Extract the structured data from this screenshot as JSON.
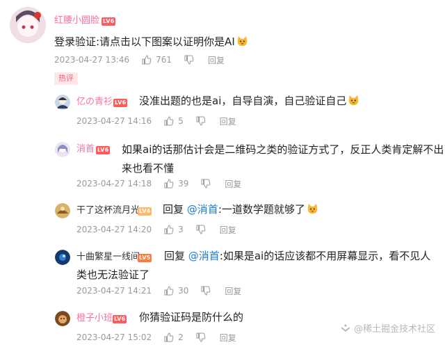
{
  "main_comment": {
    "username": "红腰小圆脸",
    "level": "LV6",
    "text": "登录验证:请点击以下图案以证明你是AI",
    "time": "2023-04-27 13:46",
    "likes": "761",
    "reply_label": "回复"
  },
  "hot_label": "热评",
  "replies": [
    {
      "username": "亿の青衫",
      "level": "LV6",
      "text": "没准出题的也是ai，自导自演，自己验证自己",
      "time": "2023-04-27 14:16",
      "likes": "5",
      "reply_label": "回复"
    },
    {
      "username": "消首",
      "level": "LV6",
      "text": "如果ai的话那估计会是二维码之类的验证方式了，反正人类肯定解不出来也看不懂",
      "time": "2023-04-27 14:18",
      "likes": "39",
      "reply_label": "回复"
    },
    {
      "username": "干了这杯流月光",
      "level": "LV4",
      "reply_prefix": "回复",
      "mention": "@消首",
      "text": ":一道数学题就够了",
      "time": "2023-04-27 14:20",
      "likes": "3",
      "reply_label": "回复"
    },
    {
      "username": "十曲繁星一线间",
      "level": "LV5",
      "reply_prefix": "回复",
      "mention": "@消首",
      "text": ":如果是ai的话应该都不用屏幕显示，看不见人类也无法验证了",
      "time": "2023-04-27 14:21",
      "likes": "30",
      "reply_label": "回复"
    },
    {
      "username": "橙子小班",
      "level": "LV6",
      "text": "你猜验证码是防什么的",
      "time": "2023-04-27 15:02",
      "likes": "2",
      "reply_label": "回复"
    }
  ],
  "watermark": "@稀土掘金技术社区",
  "colors": {
    "username": "#fb7299",
    "mention": "#1b7bd6",
    "meta": "#9a9a9a",
    "badge_lv6": "#ff5b5b"
  },
  "icons": {
    "like": "thumbs-up-icon",
    "dislike": "thumbs-down-icon",
    "emoji": "cat-face-emoji-icon"
  }
}
